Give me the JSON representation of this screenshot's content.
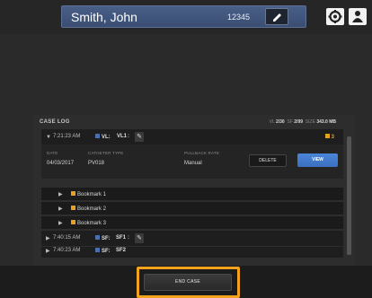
{
  "header": {
    "patient_name": "Smith, John",
    "patient_id": "12345",
    "edit_icon": "pencil-icon",
    "settings_icon": "gear-icon",
    "user_icon": "user-icon"
  },
  "case_log": {
    "title": "CASE LOG",
    "stats": {
      "vl_label": "VL",
      "vl_value": "2/30",
      "sf_label": "SF",
      "sf_value": "2/99",
      "size_label": "SIZE",
      "size_value": "343.0 MB"
    },
    "rows": [
      {
        "time": "7:21:23 AM",
        "tags": [
          "VL",
          "VL1"
        ],
        "bookmark_count": "3",
        "details": {
          "date_label": "DATE",
          "date_value": "04/03/2017",
          "catheter_label": "CATHETER TYPE",
          "catheter_value": "PV018",
          "pullback_label": "PULLBACK RATE",
          "pullback_value": "Manual",
          "delete_label": "DELETE",
          "view_label": "VIEW"
        },
        "bookmarks": [
          "Bookmark 1",
          "Bookmark 2",
          "Bookmark 3"
        ]
      },
      {
        "time": "7:40:15 AM",
        "tags": [
          "SF",
          "SF1"
        ]
      },
      {
        "time": "7:40:23 AM",
        "tags": [
          "SF",
          "SF2"
        ]
      }
    ]
  },
  "footer": {
    "end_case_label": "END CASE",
    "highlight_color": "#f2a31b"
  },
  "colors": {
    "accent_blue": "#3c6fbf",
    "bookmark_orange": "#e8a020",
    "header_bar": "#3a4e74"
  }
}
